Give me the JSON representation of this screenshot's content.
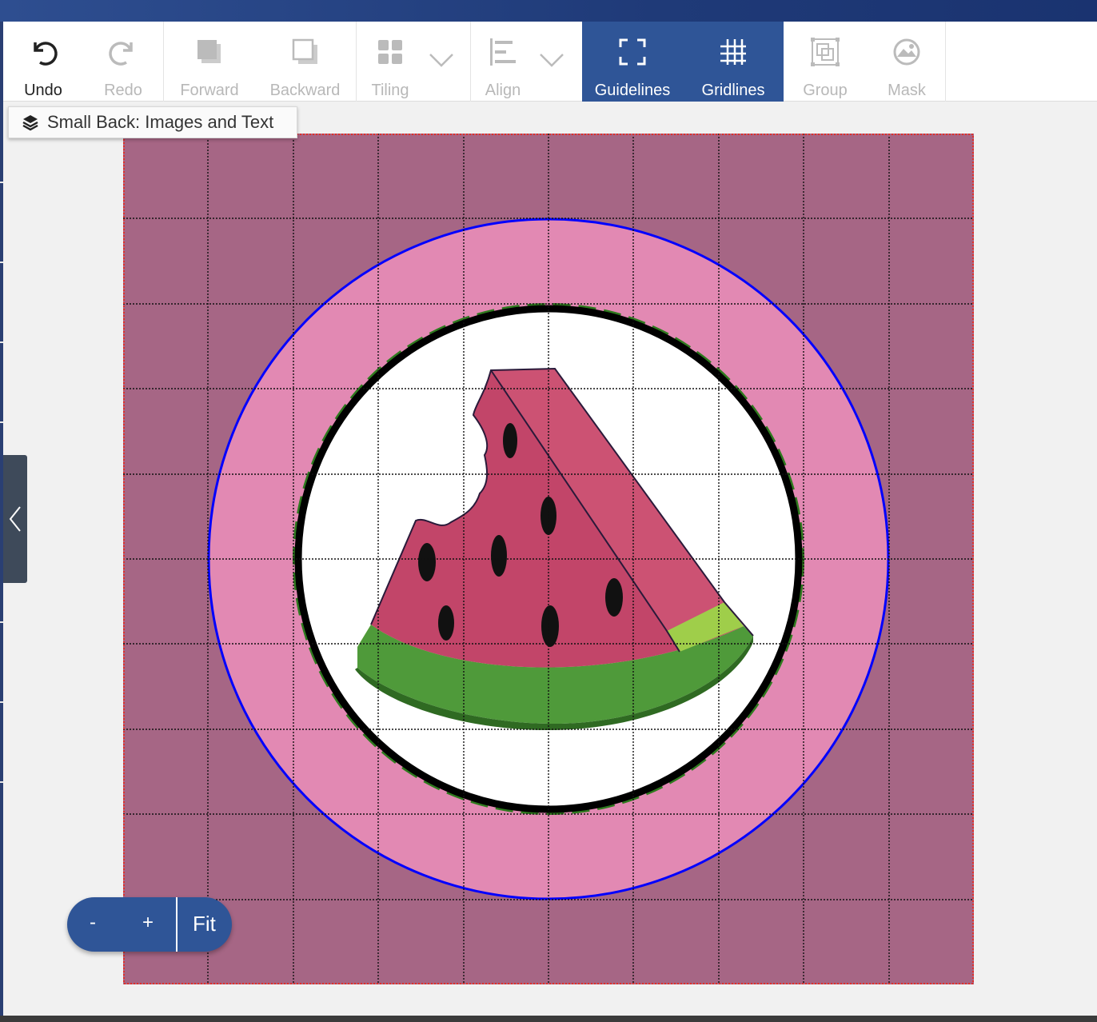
{
  "toolbar": {
    "undo": "Undo",
    "redo": "Redo",
    "forward": "Forward",
    "backward": "Backward",
    "tiling": "Tiling",
    "align": "Align",
    "guidelines": "Guidelines",
    "gridlines": "Gridlines",
    "group": "Group",
    "mask": "Mask"
  },
  "layer": {
    "label": "Small Back: Images and Text",
    "icon": "layers-icon"
  },
  "zoom": {
    "minus": "-",
    "plus": "+",
    "fit": "Fit"
  },
  "colors": {
    "active_tool": "#2f5597",
    "canvas_bg": "#a66685",
    "pink_ring": "#e289b3",
    "guide_circle": "#0000ff",
    "safe_circle_dashed": "#2f7a1f",
    "bleed_edge": "#e0302a"
  },
  "canvas": {
    "grid_columns": 10,
    "grid_rows": 10
  }
}
